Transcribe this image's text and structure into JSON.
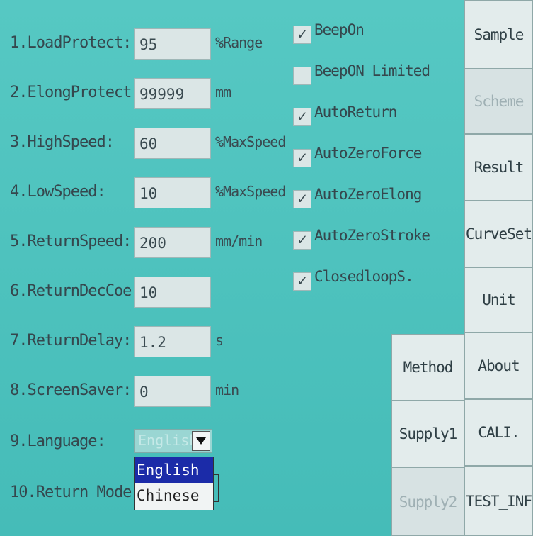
{
  "params": [
    {
      "label": "1.LoadProtect:",
      "value": "95",
      "unit": "%Range"
    },
    {
      "label": "2.ElongProtect:",
      "value": "99999",
      "unit": "mm"
    },
    {
      "label": "3.HighSpeed:",
      "value": "60",
      "unit": "%MaxSpeed"
    },
    {
      "label": "4.LowSpeed:",
      "value": "10",
      "unit": "%MaxSpeed"
    },
    {
      "label": "5.ReturnSpeed:",
      "value": "200",
      "unit": "mm/min"
    },
    {
      "label": "6.ReturnDecCoe.:",
      "value": "10",
      "unit": ""
    },
    {
      "label": "7.ReturnDelay:",
      "value": "1.2",
      "unit": "s"
    },
    {
      "label": "8.ScreenSaver:",
      "value": "0",
      "unit": "min"
    }
  ],
  "language": {
    "label": "9.Language:",
    "value": "English",
    "options": [
      "English",
      "Chinese"
    ]
  },
  "return_mode": {
    "label": "10.Return Mode:"
  },
  "checkboxes": [
    {
      "label": "BeepOn",
      "checked": "✓"
    },
    {
      "label": "BeepON_Limited",
      "checked": ""
    },
    {
      "label": "AutoReturn",
      "checked": "✓"
    },
    {
      "label": "AutoZeroForce",
      "checked": "✓"
    },
    {
      "label": "AutoZeroElong",
      "checked": "✓"
    },
    {
      "label": "AutoZeroStroke",
      "checked": "✓"
    },
    {
      "label": "ClosedloopS.",
      "checked": "✓"
    }
  ],
  "side_buttons": [
    "Sample",
    "Scheme",
    "Result",
    "CurveSet",
    "Unit",
    "About",
    "CALI.",
    "TEST_INF"
  ],
  "mid_buttons": [
    "Method",
    "Supply1",
    "Supply2"
  ]
}
